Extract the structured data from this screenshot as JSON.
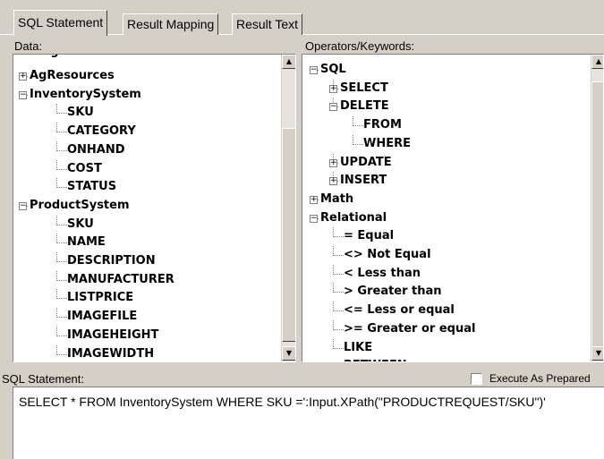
{
  "tabs": [
    {
      "label": "SQL Statement",
      "active": true
    },
    {
      "label": "Result Mapping",
      "active": false
    },
    {
      "label": "Result Text",
      "active": false
    }
  ],
  "data_panel": {
    "label": "Data:",
    "top_partial": "Tigfino",
    "items": [
      {
        "text": "AgResources",
        "level": 0,
        "expander": "+"
      },
      {
        "text": "InventorySystem",
        "level": 0,
        "expander": "-"
      },
      {
        "text": "SKU",
        "level": 1
      },
      {
        "text": "CATEGORY",
        "level": 1
      },
      {
        "text": "ONHAND",
        "level": 1
      },
      {
        "text": "COST",
        "level": 1
      },
      {
        "text": "STATUS",
        "level": 1
      },
      {
        "text": "ProductSystem",
        "level": 0,
        "expander": "-"
      },
      {
        "text": "SKU",
        "level": 1
      },
      {
        "text": "NAME",
        "level": 1
      },
      {
        "text": "DESCRIPTION",
        "level": 1
      },
      {
        "text": "MANUFACTURER",
        "level": 1
      },
      {
        "text": "LISTPRICE",
        "level": 1
      },
      {
        "text": "IMAGEFILE",
        "level": 1
      },
      {
        "text": "IMAGEHEIGHT",
        "level": 1
      },
      {
        "text": "IMAGEWIDTH",
        "level": 1
      }
    ]
  },
  "operators_panel": {
    "label": "Operators/Keywords:",
    "bottom_partial": "BETWEEN",
    "items": [
      {
        "text": "SQL",
        "level": 0,
        "expander": "-"
      },
      {
        "text": "SELECT",
        "level": 1,
        "expander": "+"
      },
      {
        "text": "DELETE",
        "level": 1,
        "expander": "-"
      },
      {
        "text": "FROM",
        "level": 2
      },
      {
        "text": "WHERE",
        "level": 2
      },
      {
        "text": "UPDATE",
        "level": 1,
        "expander": "+"
      },
      {
        "text": "INSERT",
        "level": 1,
        "expander": "+"
      },
      {
        "text": "Math",
        "level": 0,
        "expander": "+"
      },
      {
        "text": "Relational",
        "level": 0,
        "expander": "-"
      },
      {
        "text": "= Equal",
        "level": 1
      },
      {
        "text": "<> Not Equal",
        "level": 1
      },
      {
        "text": "< Less than",
        "level": 1
      },
      {
        "text": "> Greater than",
        "level": 1
      },
      {
        "text": "<= Less or equal",
        "level": 1
      },
      {
        "text": ">= Greater or equal",
        "level": 1
      },
      {
        "text": "LIKE",
        "level": 1
      }
    ]
  },
  "sql": {
    "label": "SQL Statement:",
    "checkbox_label": "Execute As Prepared",
    "checked": false,
    "text": "SELECT * FROM InventorySystem WHERE SKU =':Input.XPath(\"PRODUCTREQUEST/SKU\")'"
  }
}
